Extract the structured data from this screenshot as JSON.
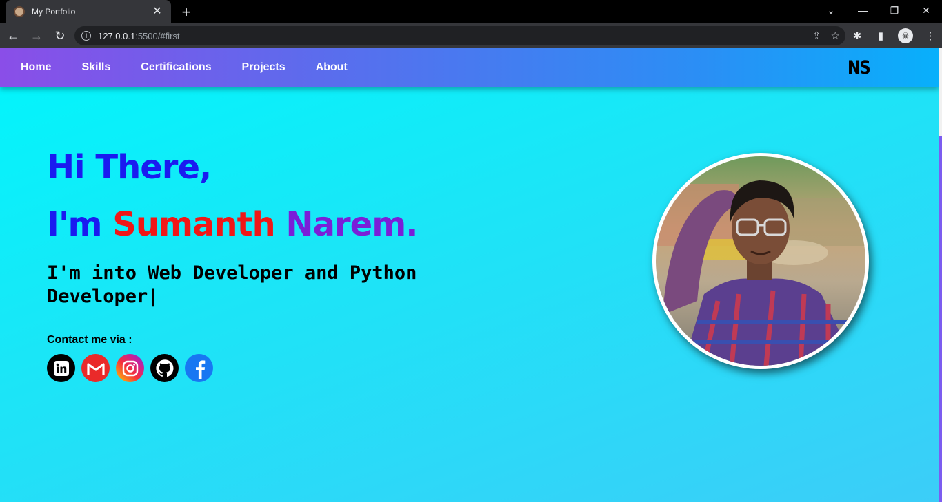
{
  "browser": {
    "tab_title": "My Portfolio",
    "url_host": "127.0.0.1",
    "url_path": ":5500/#first"
  },
  "nav": {
    "links": [
      "Home",
      "Skills",
      "Certifications",
      "Projects",
      "About"
    ],
    "logo": "NS"
  },
  "hero": {
    "greeting": "Hi There,",
    "im_prefix": "I'm ",
    "first_name": "Sumanth",
    "last_name": " Narem.",
    "role_text": "I'm into Web Developer and Python Developer|",
    "contact_label": "Contact me via :",
    "socials": [
      {
        "name": "linkedin-icon",
        "color": "#000000"
      },
      {
        "name": "gmail-icon",
        "color": "#ea2a2a"
      },
      {
        "name": "instagram-icon",
        "color": "#e1306c"
      },
      {
        "name": "github-icon",
        "color": "#000000"
      },
      {
        "name": "facebook-icon",
        "color": "#1877f2"
      }
    ]
  },
  "colors": {
    "greeting": "#1a1bf0",
    "first_name": "#f01717",
    "last_name": "#7a1fd8",
    "nav_gradient_start": "#8a4ee8",
    "nav_gradient_end": "#08b0fb",
    "page_bg": "#00f6fc"
  }
}
